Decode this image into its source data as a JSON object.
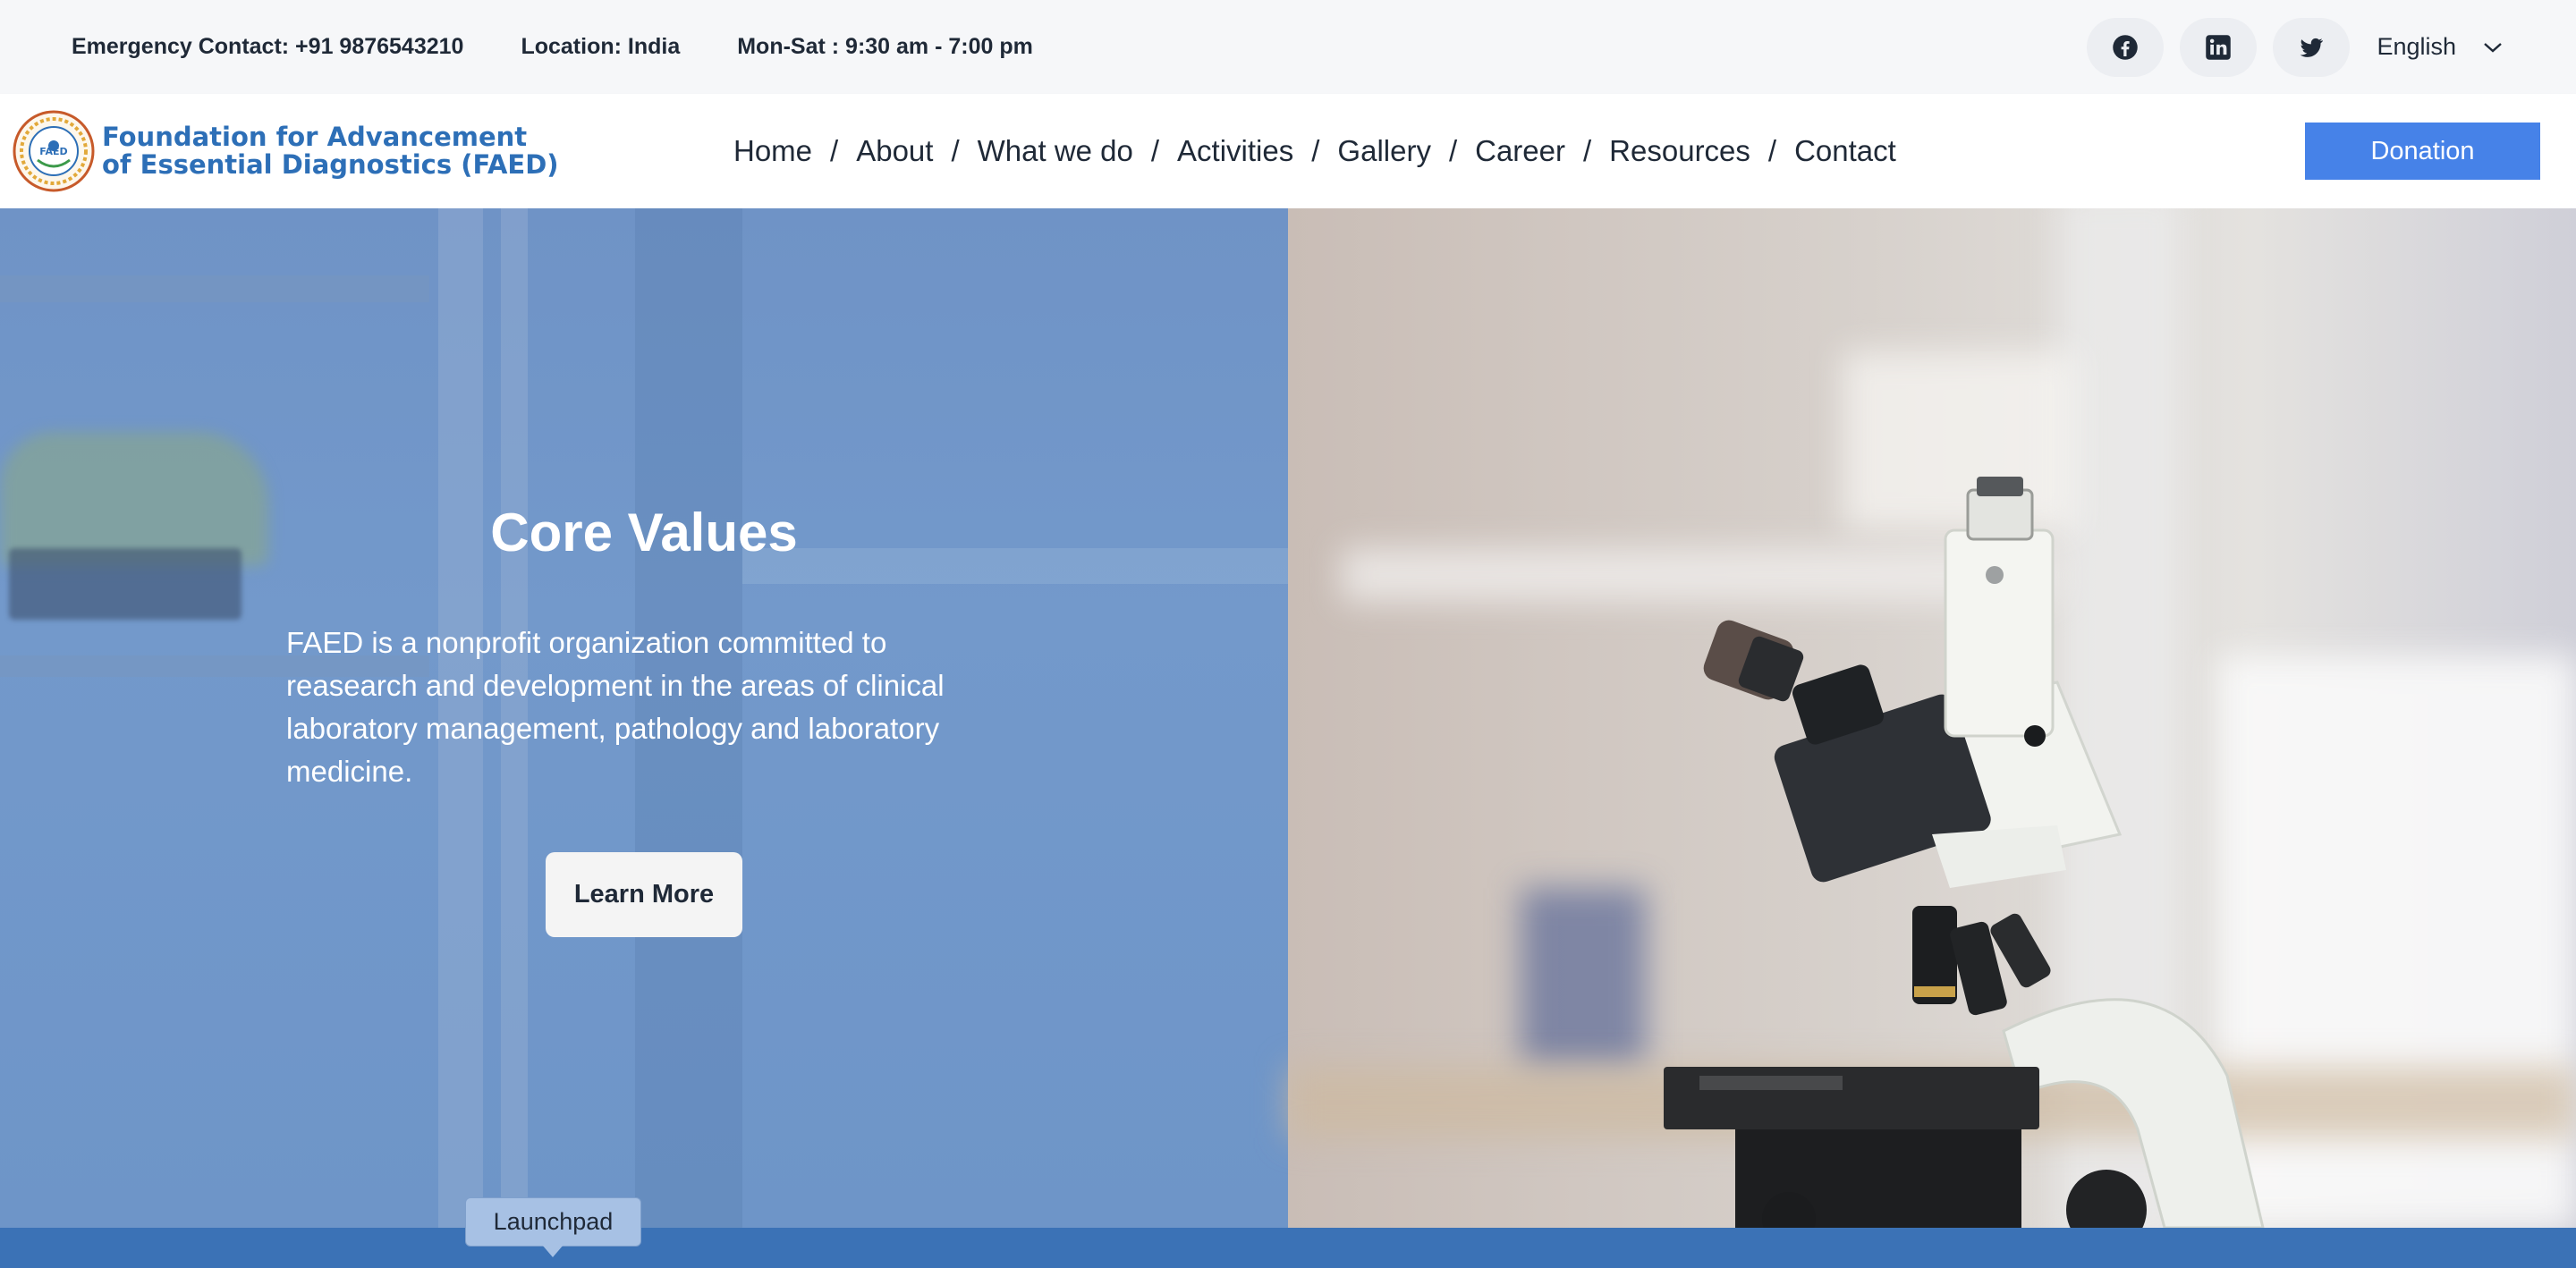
{
  "topbar": {
    "emergency": "Emergency Contact: +91 9876543210",
    "location": "Location: India",
    "hours": "Mon-Sat : 9:30 am - 7:00 pm",
    "social": [
      "facebook-icon",
      "linkedin-icon",
      "twitter-icon"
    ],
    "language": "English"
  },
  "header": {
    "logo_line1": "Foundation for Advancement",
    "logo_line2": "of Essential Diagnostics (FAED)",
    "logo_seal_text": "FAED",
    "nav": [
      "Home",
      "About",
      "What we do",
      "Activities",
      "Gallery",
      "Career",
      "Resources",
      "Contact"
    ],
    "nav_separator": "/",
    "donation": "Donation"
  },
  "hero": {
    "title": "Core Values",
    "text": "FAED is a nonprofit organization committed to reasearch and development in the areas of clinical laboratory management, pathology and laboratory medicine.",
    "button": "Learn More"
  },
  "dock": {
    "tooltip": "Launchpad"
  },
  "colors": {
    "accent": "#4682e8",
    "logo_blue": "#2d6fb7",
    "hero_overlay": "#7399cb",
    "bottom_bar": "#3b72b6"
  }
}
